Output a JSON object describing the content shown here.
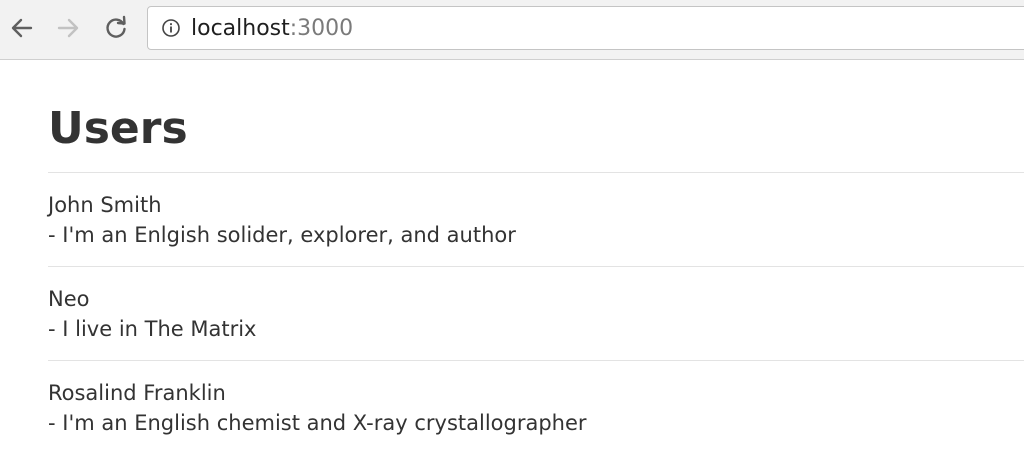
{
  "browser": {
    "url_host": "localhost",
    "url_port": ":3000"
  },
  "page": {
    "title": "Users"
  },
  "users": [
    {
      "name": "John Smith",
      "bio": "- I'm an Enlgish solider, explorer, and author"
    },
    {
      "name": "Neo",
      "bio": "- I live in The Matrix"
    },
    {
      "name": "Rosalind Franklin",
      "bio": "- I'm an English chemist and X-ray crystallographer"
    }
  ]
}
